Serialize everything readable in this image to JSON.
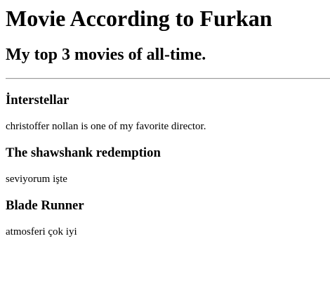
{
  "page": {
    "title": "Movie According to Furkan",
    "subtitle": "My top 3 movies of all-time."
  },
  "movies": [
    {
      "title": "İnterstellar",
      "comment": "christoffer nollan is one of my favorite director."
    },
    {
      "title": "The shawshank redemption",
      "comment": "seviyorum işte"
    },
    {
      "title": "Blade Runner",
      "comment": "atmosferi çok iyi"
    }
  ]
}
